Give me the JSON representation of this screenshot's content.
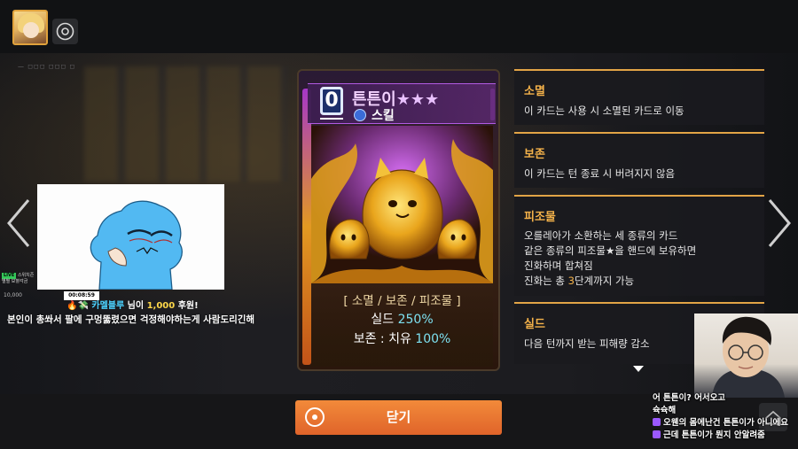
{
  "card": {
    "cost": "0",
    "name": "튼튼이",
    "stars": "★★★",
    "type": "스킬",
    "keywords": "[ 소멸 / 보존 / 피조물 ]",
    "stat1_label": "실드",
    "stat1_value": "250%",
    "stat2_label": "보존 : 치유",
    "stat2_value": "100%"
  },
  "keywords": [
    {
      "title": "소멸",
      "lines": [
        "이 카드는 사용 시 소멸된 카드로 이동"
      ]
    },
    {
      "title": "보존",
      "lines": [
        "이 카드는 턴 종료 시 버려지지 않음"
      ]
    },
    {
      "title": "피조물",
      "lines": [
        "오를레아가 소환하는 세 종류의 카드",
        "같은 종류의 피조물★을 핸드에 보유하면",
        "진화하며 합쳐짐"
      ],
      "last_prefix": "진화는 총 ",
      "last_num": "3",
      "last_suffix": "단계까지 가능"
    },
    {
      "title": "실드",
      "lines": [
        "다음 턴까지 받는 피해량 감소"
      ]
    }
  ],
  "close_label": "닫기",
  "stream": {
    "donation_nick": "카멜블루",
    "donation_mid": " 님이 ",
    "donation_amount": "1,000",
    "donation_suffix": " 후원!",
    "donation_message": "본인이 총쏴서 팔에 구멍뚫렸으면 걱정해야하는게 사람도리긴해",
    "timer": "00:08:59",
    "side_live": "LIVE",
    "side_line1": "스위치즌",
    "side_line2": "별별 보혈각금",
    "viewer_count": "10,000"
  },
  "chat": [
    {
      "text": "어 튼튼이? 어서오고",
      "icon": false
    },
    {
      "text": "슉슉해",
      "icon": false
    },
    {
      "text": "오웬의 몸에난건 튼튼이가 아니에요",
      "icon": true
    },
    {
      "text": "근데 튼튼이가 뭔지 안알려줌",
      "icon": true
    }
  ],
  "colors": {
    "accent": "#e2a446",
    "close_button": "#e8742f",
    "highlight_cyan": "#7de0f0",
    "card_name": "#f3d2ff"
  },
  "icons": [
    "settings-icon",
    "left-arrow-icon",
    "right-arrow-icon",
    "close-circle-icon",
    "home-icon",
    "skill-type-icon",
    "scroll-down-icon"
  ]
}
